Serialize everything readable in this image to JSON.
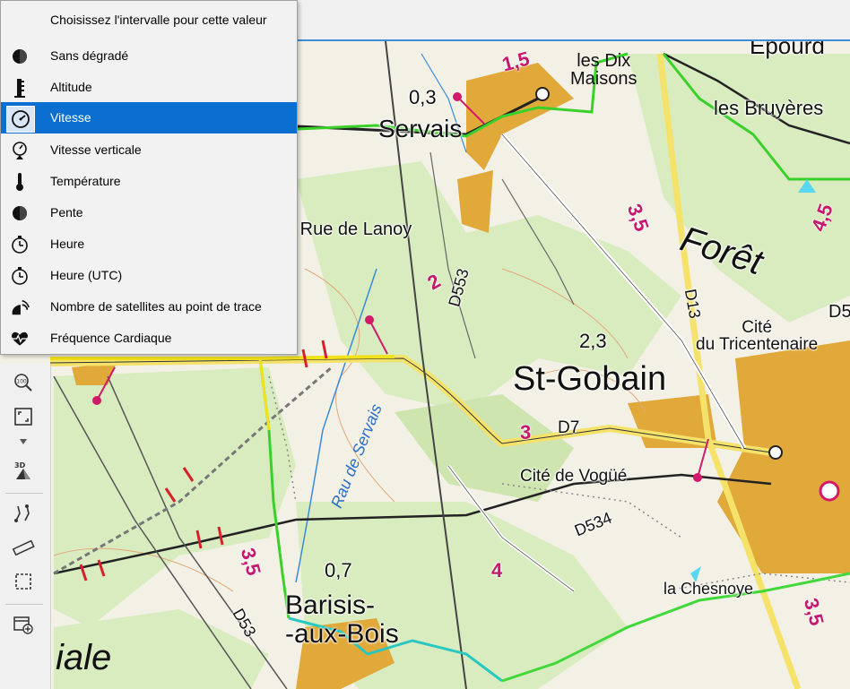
{
  "menu": {
    "header": "Choisissez l'intervalle pour cette valeur",
    "items": [
      {
        "label": "Sans dégradé",
        "icon": "circle-half-icon",
        "selected": false
      },
      {
        "label": "Altitude",
        "icon": "altitude-ruler-icon",
        "selected": false
      },
      {
        "label": "Vitesse",
        "icon": "speedometer-icon",
        "selected": true
      },
      {
        "label": "Vitesse verticale",
        "icon": "vertical-speed-icon",
        "selected": false
      },
      {
        "label": "Température",
        "icon": "thermometer-icon",
        "selected": false
      },
      {
        "label": "Pente",
        "icon": "slope-icon",
        "selected": false
      },
      {
        "label": "Heure",
        "icon": "stopwatch-icon",
        "selected": false
      },
      {
        "label": "Heure (UTC)",
        "icon": "stopwatch-utc-icon",
        "selected": false
      },
      {
        "label": "Nombre de satellites au point de trace",
        "icon": "satellite-icon",
        "selected": false
      },
      {
        "label": "Fréquence Cardiaque",
        "icon": "heart-rate-icon",
        "selected": false
      }
    ]
  },
  "map": {
    "labels": {
      "les_dix_maisons": "les Dix\nMaisons",
      "servais": "Servais",
      "les_bruyeres": "les Bruyères",
      "rue_de_lanoy": "a Rue de Lanoy",
      "foret": "Forêt",
      "cite_tricentenaire": "Cité\ndu Tricentenaire",
      "st_gobain": "St-Gobain",
      "cite_de_vogue": "Cité de Vogüé",
      "rau_de_servais": "Rau de Servais",
      "barisis": "Barisis-\n-aux-Bois",
      "la_chesnoye": "la Chesnoye",
      "iale": "iale",
      "d553": "D553",
      "d13": "D13",
      "d7": "D7",
      "d534": "D534",
      "d53": "D53",
      "d5": "D5",
      "epourd": "Épourd",
      "alt_0_3": "0,3",
      "alt_2_3": "2,3",
      "alt_0_7": "0,7",
      "km_1_5": "1,5",
      "km_3_5_a": "3,5",
      "km_4_5": "4,5",
      "km_2": "2",
      "km_3": "3",
      "km_3_5_b": "3,5",
      "km_4": "4",
      "km_3_5_c": "3,5"
    }
  },
  "toolbar": {
    "tools": [
      "zoom-100-icon",
      "fit-extent-icon",
      "dropdown-arrow-icon",
      "3d-view-icon",
      "route-tool-icon",
      "measure-ruler-icon",
      "select-rectangle-icon",
      "add-layer-icon"
    ]
  },
  "colors": {
    "selection": "#0a6fd0",
    "track_yellow": "#f2e21a",
    "track_green": "#3ad02a",
    "forest": "#d9ecbf",
    "urban": "#e0a93a",
    "road_magenta": "#c8186e"
  }
}
